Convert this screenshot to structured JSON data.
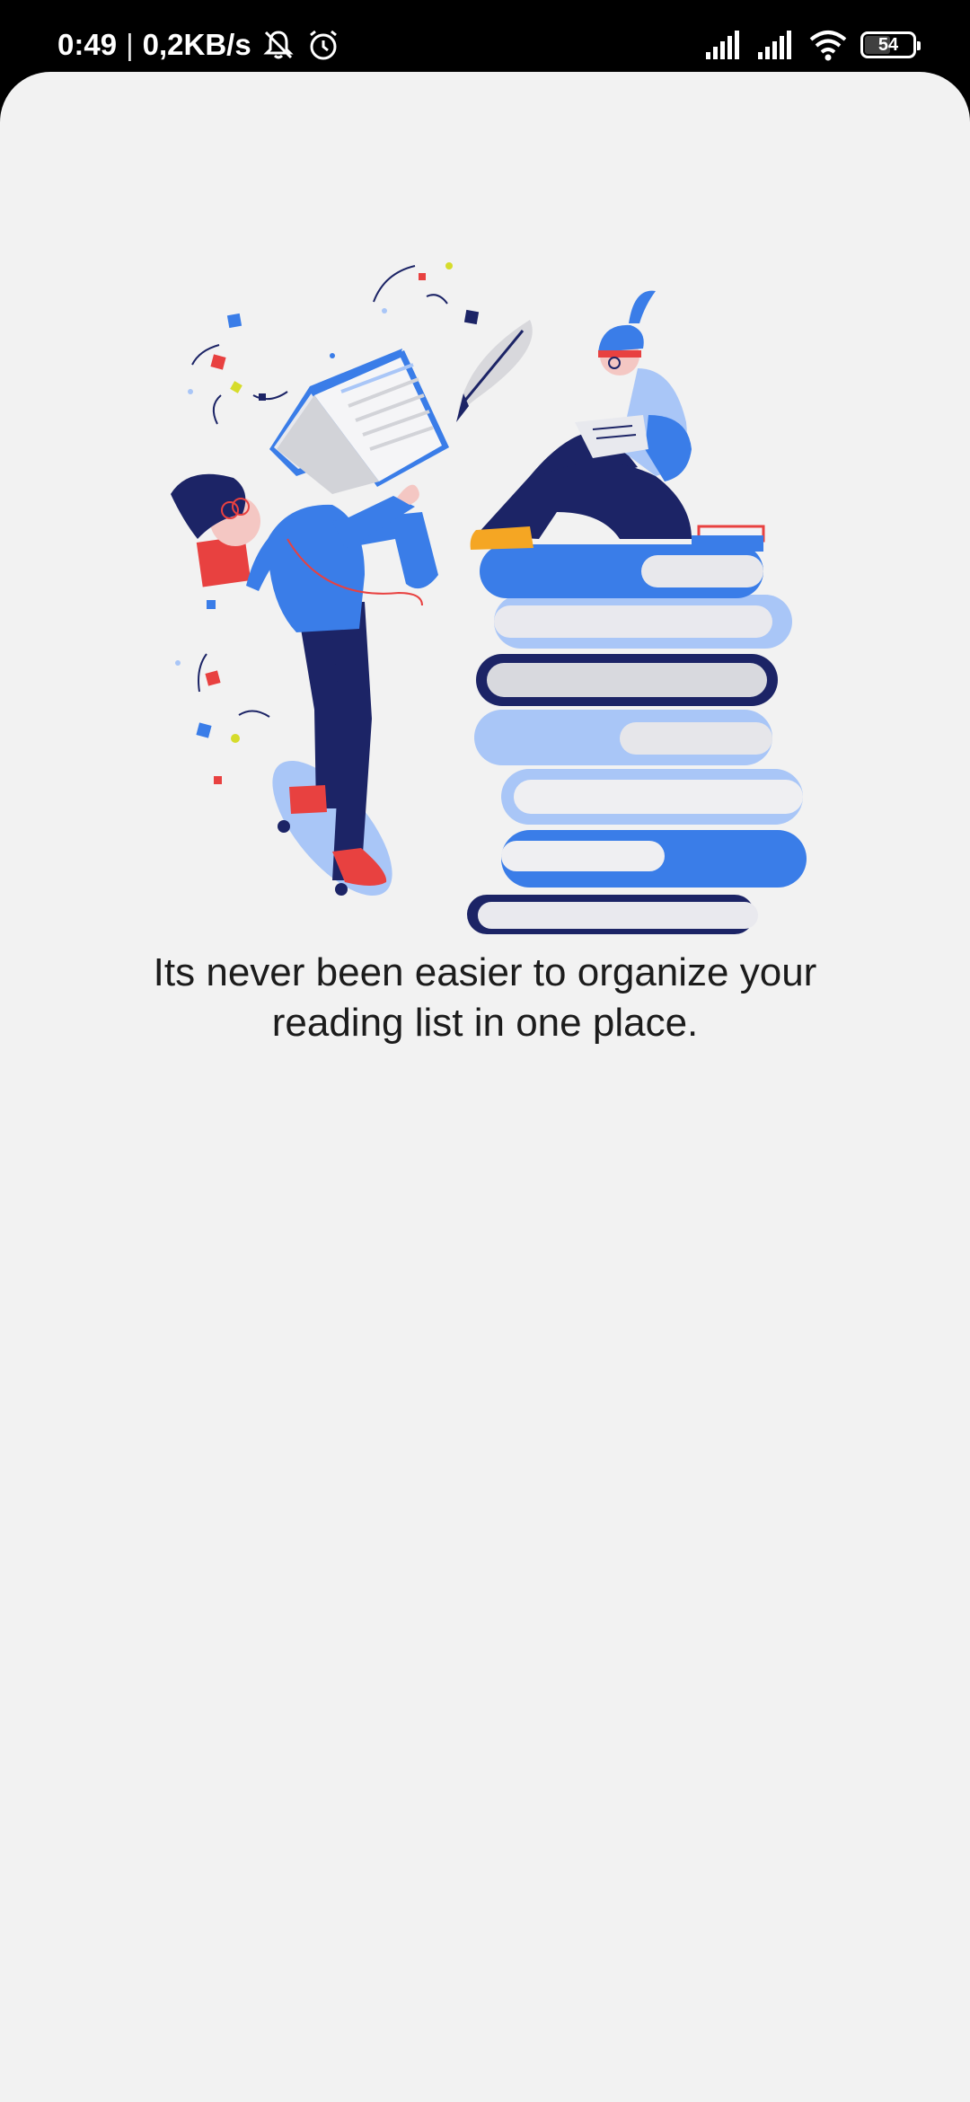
{
  "status_bar": {
    "time": "0:49",
    "separator": "|",
    "net_speed": "0,2KB/s",
    "battery_level": "54",
    "battery_fraction": 0.54,
    "icons": [
      "mute-icon",
      "alarm-icon",
      "signal-icon",
      "signal-icon",
      "wifi-icon",
      "battery-icon"
    ]
  },
  "onboarding": {
    "illustration": "reading-illustration",
    "caption_line1": "Its never been easier to organize your",
    "caption_line2": "reading list in one place."
  },
  "colors": {
    "background": "#f2f2f2",
    "status_bar": "#000000",
    "blue": "#3a7de8",
    "light_blue": "#a9c6f7",
    "navy": "#1c2466",
    "red": "#e84140"
  }
}
